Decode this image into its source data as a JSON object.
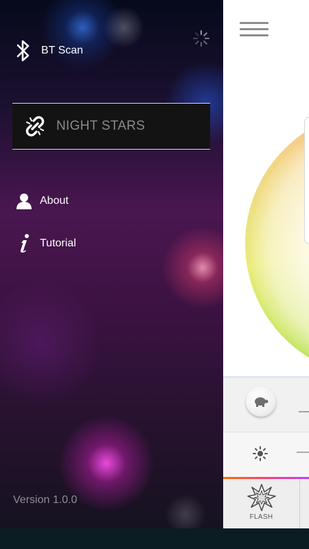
{
  "drawer": {
    "bt_scan_label": "BT Scan",
    "device_name": "NIGHT STARS",
    "menu": [
      {
        "label": "About",
        "icon": "person-icon"
      },
      {
        "label": "Tutorial",
        "icon": "info-icon"
      }
    ],
    "version": "Version 1.0.0"
  },
  "main": {
    "tabs": [
      {
        "label": "FLASH",
        "icon": "flash-burst-icon"
      }
    ]
  },
  "colors": {
    "drawer_box_bg": "#131313",
    "device_text": "#8a8a8a",
    "version_text": "#8d8d99",
    "accent_orange": "#ff6a00",
    "accent_green": "#b7e35a"
  }
}
